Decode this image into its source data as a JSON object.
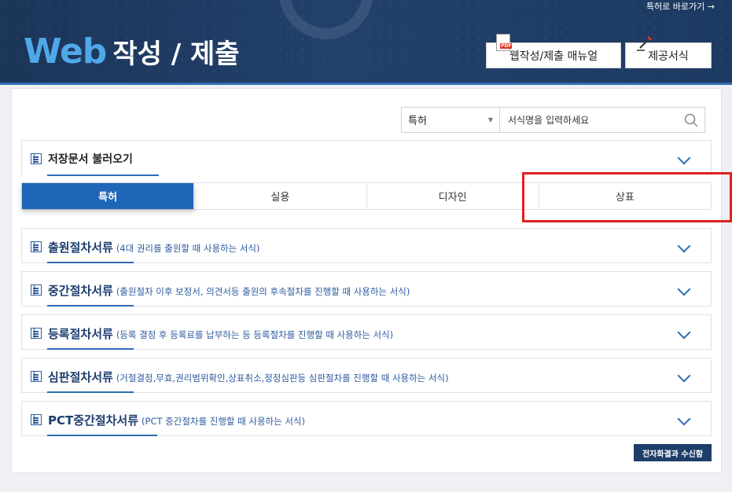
{
  "header": {
    "title_web": "Web",
    "title_rest": "작성 / 제출",
    "top_link": "특허로 바로가기 →",
    "manual_button": "웹작성/제출 매뉴얼",
    "form_button": "제공서식",
    "colors": {
      "banner": "#1c3559",
      "web_text": "#4fa8e8"
    }
  },
  "search": {
    "category": "특허",
    "placeholder": "서식명을 입력하세요"
  },
  "saved": {
    "label": "저장문서 불러오기"
  },
  "tabs": [
    {
      "label": "특허",
      "active": true
    },
    {
      "label": "실용",
      "active": false
    },
    {
      "label": "디자인",
      "active": false
    },
    {
      "label": "상표",
      "active": false
    }
  ],
  "sections": [
    {
      "title": "출원절차서류",
      "desc": "(4대 권리를 출원할 때 사용하는 서식)"
    },
    {
      "title": "중간절차서류",
      "desc": "(출원절차 이후 보정서, 의견서등 출원의 후속절차를 진행할 때 사용하는 서식)"
    },
    {
      "title": "등록절차서류",
      "desc": "(등록 결정 후 등록료를 납부하는 등 등록절차를 진행할 때 사용하는 서식)"
    },
    {
      "title": "심판절차서류",
      "desc": "(거절결정,무효,권리범위확인,상표취소,정정심판등 심판절차를 진행할 때 사용하는 서식)"
    },
    {
      "title": "PCT중간절차서류",
      "desc": "(PCT 중간절차를 진행할 때 사용하는 서식)"
    }
  ],
  "bottom_button": "전자화결과 수신함",
  "icons": {
    "search": "search-icon",
    "chevron": "chevron-down-icon",
    "doc": "document-icon"
  }
}
